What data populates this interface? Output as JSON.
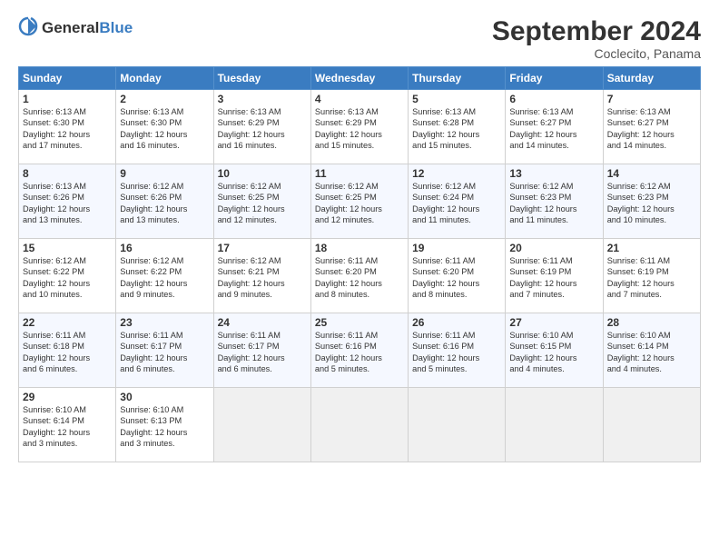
{
  "header": {
    "logo_general": "General",
    "logo_blue": "Blue",
    "month": "September 2024",
    "location": "Coclecito, Panama"
  },
  "days_of_week": [
    "Sunday",
    "Monday",
    "Tuesday",
    "Wednesday",
    "Thursday",
    "Friday",
    "Saturday"
  ],
  "weeks": [
    [
      {
        "day": 1,
        "lines": [
          "Sunrise: 6:13 AM",
          "Sunset: 6:30 PM",
          "Daylight: 12 hours",
          "and 17 minutes."
        ]
      },
      {
        "day": 2,
        "lines": [
          "Sunrise: 6:13 AM",
          "Sunset: 6:30 PM",
          "Daylight: 12 hours",
          "and 16 minutes."
        ]
      },
      {
        "day": 3,
        "lines": [
          "Sunrise: 6:13 AM",
          "Sunset: 6:29 PM",
          "Daylight: 12 hours",
          "and 16 minutes."
        ]
      },
      {
        "day": 4,
        "lines": [
          "Sunrise: 6:13 AM",
          "Sunset: 6:29 PM",
          "Daylight: 12 hours",
          "and 15 minutes."
        ]
      },
      {
        "day": 5,
        "lines": [
          "Sunrise: 6:13 AM",
          "Sunset: 6:28 PM",
          "Daylight: 12 hours",
          "and 15 minutes."
        ]
      },
      {
        "day": 6,
        "lines": [
          "Sunrise: 6:13 AM",
          "Sunset: 6:27 PM",
          "Daylight: 12 hours",
          "and 14 minutes."
        ]
      },
      {
        "day": 7,
        "lines": [
          "Sunrise: 6:13 AM",
          "Sunset: 6:27 PM",
          "Daylight: 12 hours",
          "and 14 minutes."
        ]
      }
    ],
    [
      {
        "day": 8,
        "lines": [
          "Sunrise: 6:13 AM",
          "Sunset: 6:26 PM",
          "Daylight: 12 hours",
          "and 13 minutes."
        ]
      },
      {
        "day": 9,
        "lines": [
          "Sunrise: 6:12 AM",
          "Sunset: 6:26 PM",
          "Daylight: 12 hours",
          "and 13 minutes."
        ]
      },
      {
        "day": 10,
        "lines": [
          "Sunrise: 6:12 AM",
          "Sunset: 6:25 PM",
          "Daylight: 12 hours",
          "and 12 minutes."
        ]
      },
      {
        "day": 11,
        "lines": [
          "Sunrise: 6:12 AM",
          "Sunset: 6:25 PM",
          "Daylight: 12 hours",
          "and 12 minutes."
        ]
      },
      {
        "day": 12,
        "lines": [
          "Sunrise: 6:12 AM",
          "Sunset: 6:24 PM",
          "Daylight: 12 hours",
          "and 11 minutes."
        ]
      },
      {
        "day": 13,
        "lines": [
          "Sunrise: 6:12 AM",
          "Sunset: 6:23 PM",
          "Daylight: 12 hours",
          "and 11 minutes."
        ]
      },
      {
        "day": 14,
        "lines": [
          "Sunrise: 6:12 AM",
          "Sunset: 6:23 PM",
          "Daylight: 12 hours",
          "and 10 minutes."
        ]
      }
    ],
    [
      {
        "day": 15,
        "lines": [
          "Sunrise: 6:12 AM",
          "Sunset: 6:22 PM",
          "Daylight: 12 hours",
          "and 10 minutes."
        ]
      },
      {
        "day": 16,
        "lines": [
          "Sunrise: 6:12 AM",
          "Sunset: 6:22 PM",
          "Daylight: 12 hours",
          "and 9 minutes."
        ]
      },
      {
        "day": 17,
        "lines": [
          "Sunrise: 6:12 AM",
          "Sunset: 6:21 PM",
          "Daylight: 12 hours",
          "and 9 minutes."
        ]
      },
      {
        "day": 18,
        "lines": [
          "Sunrise: 6:11 AM",
          "Sunset: 6:20 PM",
          "Daylight: 12 hours",
          "and 8 minutes."
        ]
      },
      {
        "day": 19,
        "lines": [
          "Sunrise: 6:11 AM",
          "Sunset: 6:20 PM",
          "Daylight: 12 hours",
          "and 8 minutes."
        ]
      },
      {
        "day": 20,
        "lines": [
          "Sunrise: 6:11 AM",
          "Sunset: 6:19 PM",
          "Daylight: 12 hours",
          "and 7 minutes."
        ]
      },
      {
        "day": 21,
        "lines": [
          "Sunrise: 6:11 AM",
          "Sunset: 6:19 PM",
          "Daylight: 12 hours",
          "and 7 minutes."
        ]
      }
    ],
    [
      {
        "day": 22,
        "lines": [
          "Sunrise: 6:11 AM",
          "Sunset: 6:18 PM",
          "Daylight: 12 hours",
          "and 6 minutes."
        ]
      },
      {
        "day": 23,
        "lines": [
          "Sunrise: 6:11 AM",
          "Sunset: 6:17 PM",
          "Daylight: 12 hours",
          "and 6 minutes."
        ]
      },
      {
        "day": 24,
        "lines": [
          "Sunrise: 6:11 AM",
          "Sunset: 6:17 PM",
          "Daylight: 12 hours",
          "and 6 minutes."
        ]
      },
      {
        "day": 25,
        "lines": [
          "Sunrise: 6:11 AM",
          "Sunset: 6:16 PM",
          "Daylight: 12 hours",
          "and 5 minutes."
        ]
      },
      {
        "day": 26,
        "lines": [
          "Sunrise: 6:11 AM",
          "Sunset: 6:16 PM",
          "Daylight: 12 hours",
          "and 5 minutes."
        ]
      },
      {
        "day": 27,
        "lines": [
          "Sunrise: 6:10 AM",
          "Sunset: 6:15 PM",
          "Daylight: 12 hours",
          "and 4 minutes."
        ]
      },
      {
        "day": 28,
        "lines": [
          "Sunrise: 6:10 AM",
          "Sunset: 6:14 PM",
          "Daylight: 12 hours",
          "and 4 minutes."
        ]
      }
    ],
    [
      {
        "day": 29,
        "lines": [
          "Sunrise: 6:10 AM",
          "Sunset: 6:14 PM",
          "Daylight: 12 hours",
          "and 3 minutes."
        ]
      },
      {
        "day": 30,
        "lines": [
          "Sunrise: 6:10 AM",
          "Sunset: 6:13 PM",
          "Daylight: 12 hours",
          "and 3 minutes."
        ]
      },
      null,
      null,
      null,
      null,
      null
    ]
  ]
}
